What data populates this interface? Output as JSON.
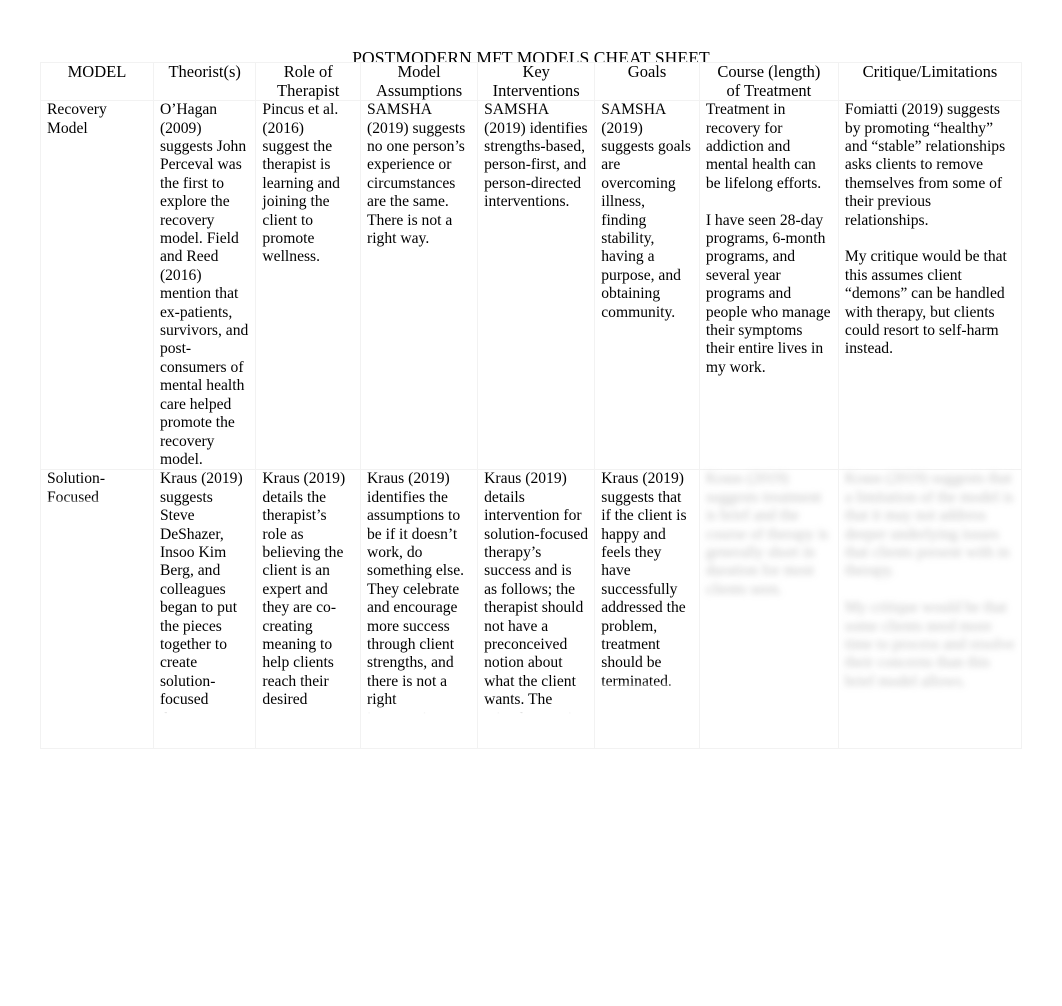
{
  "document": {
    "title": "POSTMODERN MFT MODELS CHEAT SHEET"
  },
  "table": {
    "headers": {
      "model": "MODEL",
      "theorists": "Theorist(s)",
      "role_line1": "Role of",
      "role_line2": "Therapist",
      "assumptions_line1": "Model",
      "assumptions_line2": "Assumptions",
      "interventions_line1": "Key",
      "interventions_line2": "Interventions",
      "goals": "Goals",
      "course_line1": "Course (length)",
      "course_line2": "of Treatment",
      "critique": "Critique/Limitations"
    },
    "rows": [
      {
        "model": "Recovery Model",
        "theorists": "O’Hagan (2009) suggests John Perceval was the first to explore the recovery model. Field and Reed (2016) mention that ex-patients, survivors, and post-consumers of mental health care helped promote the recovery model.",
        "role_of_therapist": "Pincus et al. (2016) suggest the therapist is learning and joining the client to promote wellness.",
        "model_assumptions": "SAMSHA (2019) suggests no one person’s experience or circumstances are the same. There is not a right way.",
        "key_interventions": "SAMSHA (2019) identifies strengths-based, person-first, and person-directed interventions.",
        "goals": "SAMSHA (2019) suggests goals are overcoming illness, finding stability, having a purpose, and obtaining community.",
        "course_of_treatment_p1": "Treatment in recovery for addiction and mental health can be lifelong efforts.",
        "course_of_treatment_p2": "I have seen 28-day programs, 6-month programs, and several year programs and people who manage their symptoms their entire lives in my work.",
        "critique_p1": "Fomiatti (2019) suggests by promoting “healthy” and “stable” relationships asks clients to remove themselves from some of their previous relationships.",
        "critique_p2": "My critique would be that this assumes client “demons” can be handled with therapy, but clients could resort to self-harm instead."
      },
      {
        "model": "Solution-Focused",
        "theorists": "Kraus (2019) suggests Steve DeShazer, Insoo Kim Berg, and colleagues began to put the pieces together to create solution-focused therapy.",
        "role_of_therapist": "Kraus (2019) details the therapist’s role as believing the client is an expert and they are co-creating meaning to help clients reach their desired outcomes.",
        "model_assumptions": "Kraus (2019) identifies the assumptions to be if it doesn’t work, do something else. They celebrate and encourage more success through client strengths, and there is not a right intervention.",
        "key_interventions": "Kraus (2019) details intervention for solution-focused therapy’s success and is as follows; the therapist should not have a preconceived notion about what the client wants. The miracle question should promote",
        "goals": "Kraus (2019) suggests that if the client is happy and feels they have successfully addressed the problem, treatment should be terminated.",
        "course_of_treatment_p1": "Kraus (2019) suggests treatment is brief and the course of therapy is generally short in duration for most clients seen.",
        "course_of_treatment_p2": "",
        "critique_p1": "Kraus (2019) suggests that a limitation of the model is that it may not address deeper underlying issues that clients present with in therapy.",
        "critique_p2": "My critique would be that some clients need more time to process and resolve their concerns than this brief model allows."
      }
    ]
  }
}
